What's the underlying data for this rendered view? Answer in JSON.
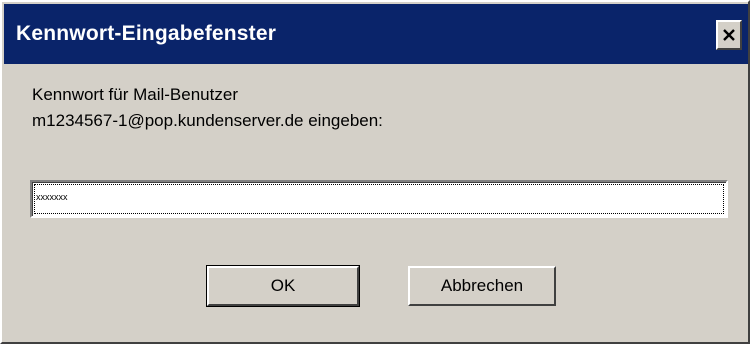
{
  "window": {
    "title": "Kennwort-Eingabefenster",
    "close_icon": "close-icon"
  },
  "prompt": {
    "line1": "Kennwort für Mail-Benutzer",
    "line2": "m1234567-1@pop.kundenserver.de eingeben:"
  },
  "password": {
    "value": "xxxxxxx"
  },
  "buttons": {
    "ok_label": "OK",
    "cancel_label": "Abbrechen"
  },
  "colors": {
    "titlebar": "#0a246a",
    "face": "#d4d0c8"
  }
}
